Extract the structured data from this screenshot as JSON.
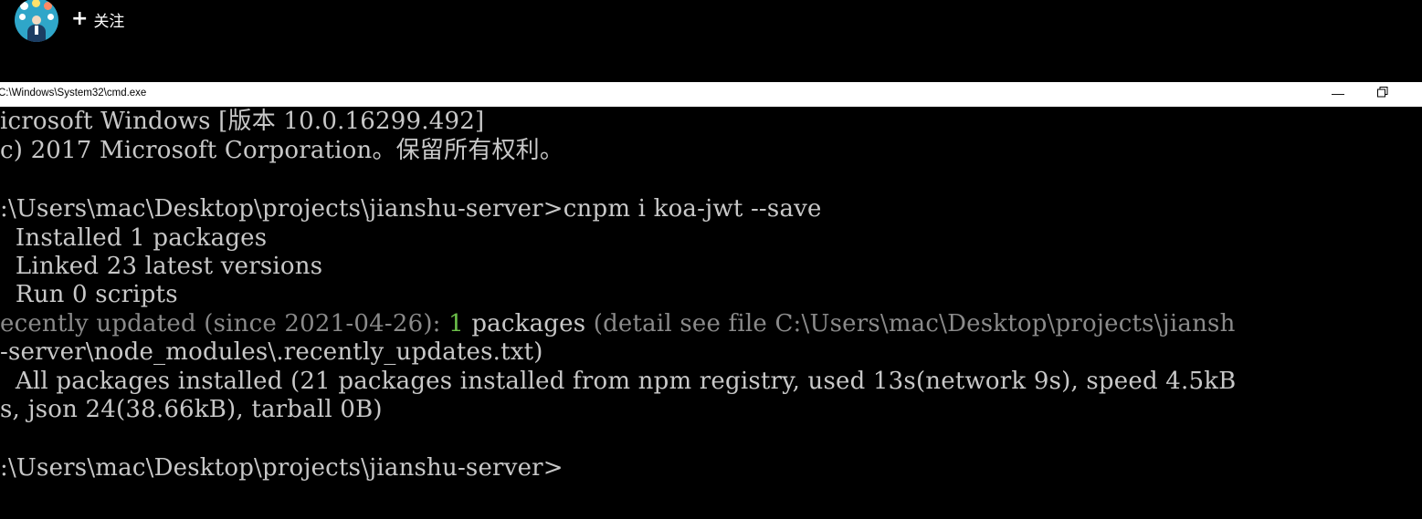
{
  "overlay": {
    "follow_label": "关注",
    "plus": "+"
  },
  "window": {
    "title": "C:\\Windows\\System32\\cmd.exe",
    "minimize_glyph": "—"
  },
  "console": {
    "lines": [
      "icrosoft Windows [版本 10.0.16299.492]",
      "c) 2017 Microsoft Corporation。保留所有权利。",
      "",
      ":\\Users\\mac\\Desktop\\projects\\jianshu-server>cnpm i koa-jwt --save",
      "  Installed 1 packages",
      "  Linked 23 latest versions",
      "  Run 0 scripts",
      "ecently updated (since 2021-04-26): 1 packages (detail see file C:\\Users\\mac\\Desktop\\projects\\jiansh",
      "-server\\node_modules\\.recently_updates.txt)",
      "  All packages installed (21 packages installed from npm registry, used 13s(network 9s), speed 4.5kB",
      "s, json 24(38.66kB), tarball 0B)",
      "",
      ":\\Users\\mac\\Desktop\\projects\\jianshu-server>"
    ],
    "recent_prefix": "ecently updated (since 2021-04-26): ",
    "recent_count": "1",
    "recent_mid": " packages ",
    "recent_suffix": "(detail see file C:\\Users\\mac\\Desktop\\projects\\jiansh",
    "recent_line2": "-server\\node_modules\\.recently_updates.txt)"
  },
  "colors": {
    "console_bg": "#000000",
    "console_text": "#c8c8c8",
    "highlight": "#6cc04a",
    "dim": "#8a8a8a"
  }
}
